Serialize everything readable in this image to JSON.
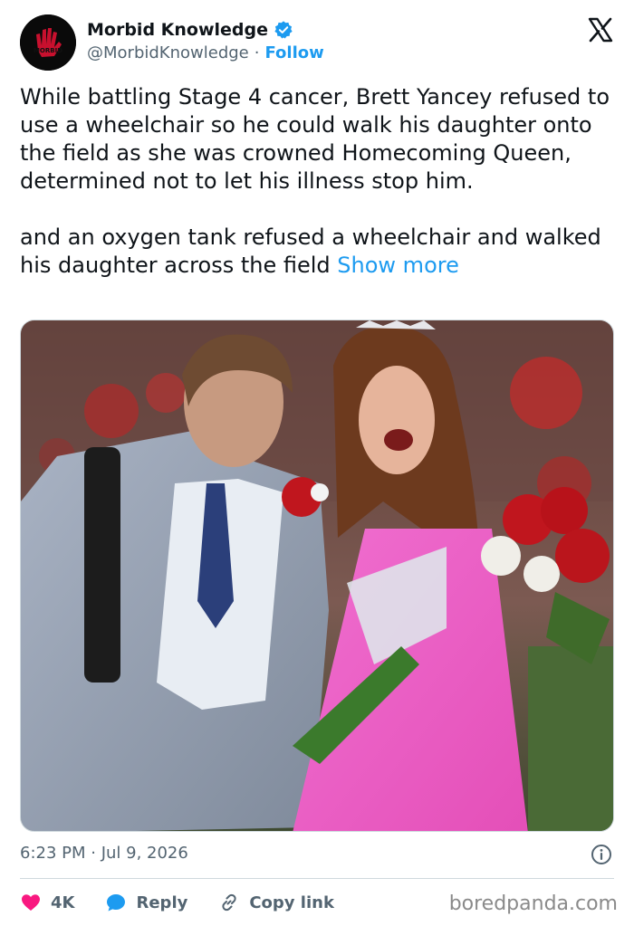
{
  "author": {
    "name": "Morbid Knowledge",
    "handle": "@MorbidKnowledge",
    "separator": "·",
    "follow_label": "Follow",
    "avatar_text": "MORBID"
  },
  "tweet": {
    "paragraph_1": "While battling Stage 4 cancer, Brett Yancey refused to use a wheelchair so he could walk his daughter onto the field as she was crowned Homecoming Queen, determined not to let his illness stop him.",
    "paragraph_2": "and an oxygen tank refused a wheelchair and walked his daughter across the field",
    "show_more_label": "Show more"
  },
  "meta": {
    "timestamp": "6:23 PM · Jul 9, 2026"
  },
  "actions": {
    "like_count": "4K",
    "reply_label": "Reply",
    "copy_link_label": "Copy link"
  },
  "watermark": "boredpanda.com",
  "colors": {
    "accent": "#1d9bf0",
    "like": "#f91880",
    "text": "#0f1419",
    "muted": "#536471"
  },
  "icons": [
    "verified-badge-icon",
    "x-logo-icon",
    "info-icon",
    "heart-icon",
    "reply-bubble-icon",
    "link-icon"
  ]
}
